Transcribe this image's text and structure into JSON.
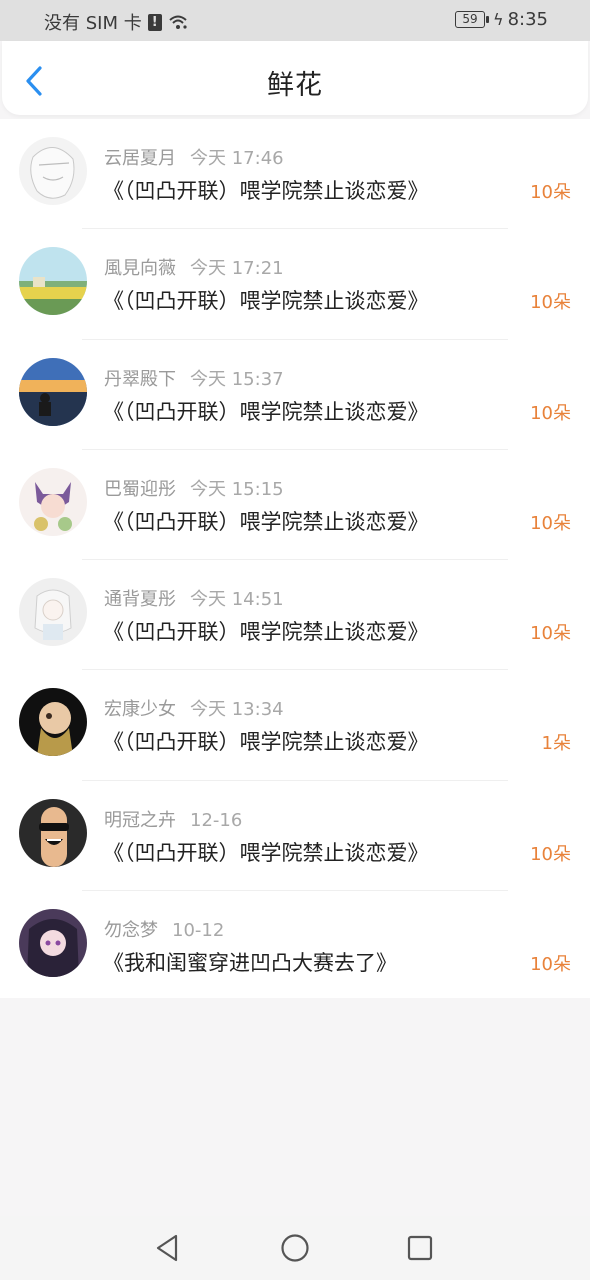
{
  "status_bar": {
    "carrier": "没有 SIM 卡",
    "alert_icon": "sim-alert-icon",
    "wifi_icon": "wifi-icon",
    "battery": "59",
    "time": "8:35"
  },
  "header": {
    "title": "鲜花",
    "back_icon": "chevron-left-icon",
    "accent_color": "#2b8ff0"
  },
  "colors": {
    "flower_count": "#e8823a",
    "username": "#9a9a9a"
  },
  "items": [
    {
      "user": "云居夏月",
      "time": "今天 17:46",
      "title": "《（凹凸开联）喂学院禁止谈恋爱》",
      "count": "10朵"
    },
    {
      "user": "風見向薇",
      "time": "今天 17:21",
      "title": "《（凹凸开联）喂学院禁止谈恋爱》",
      "count": "10朵"
    },
    {
      "user": "丹翠殿下",
      "time": "今天 15:37",
      "title": "《（凹凸开联）喂学院禁止谈恋爱》",
      "count": "10朵"
    },
    {
      "user": "巴蜀迎彤",
      "time": "今天 15:15",
      "title": "《（凹凸开联）喂学院禁止谈恋爱》",
      "count": "10朵"
    },
    {
      "user": "通背夏彤",
      "time": "今天 14:51",
      "title": "《（凹凸开联）喂学院禁止谈恋爱》",
      "count": "10朵"
    },
    {
      "user": "宏康少女",
      "time": "今天 13:34",
      "title": "《（凹凸开联）喂学院禁止谈恋爱》",
      "count": "1朵"
    },
    {
      "user": "明冠之卉",
      "time": "12-16",
      "title": "《（凹凸开联）喂学院禁止谈恋爱》",
      "count": "10朵"
    },
    {
      "user": "勿念梦",
      "time": "10-12",
      "title": "《我和闺蜜穿进凹凸大赛去了》",
      "count": "10朵"
    }
  ],
  "nav": {
    "back_icon": "triangle-back-icon",
    "home_icon": "circle-home-icon",
    "recents_icon": "square-recents-icon"
  }
}
